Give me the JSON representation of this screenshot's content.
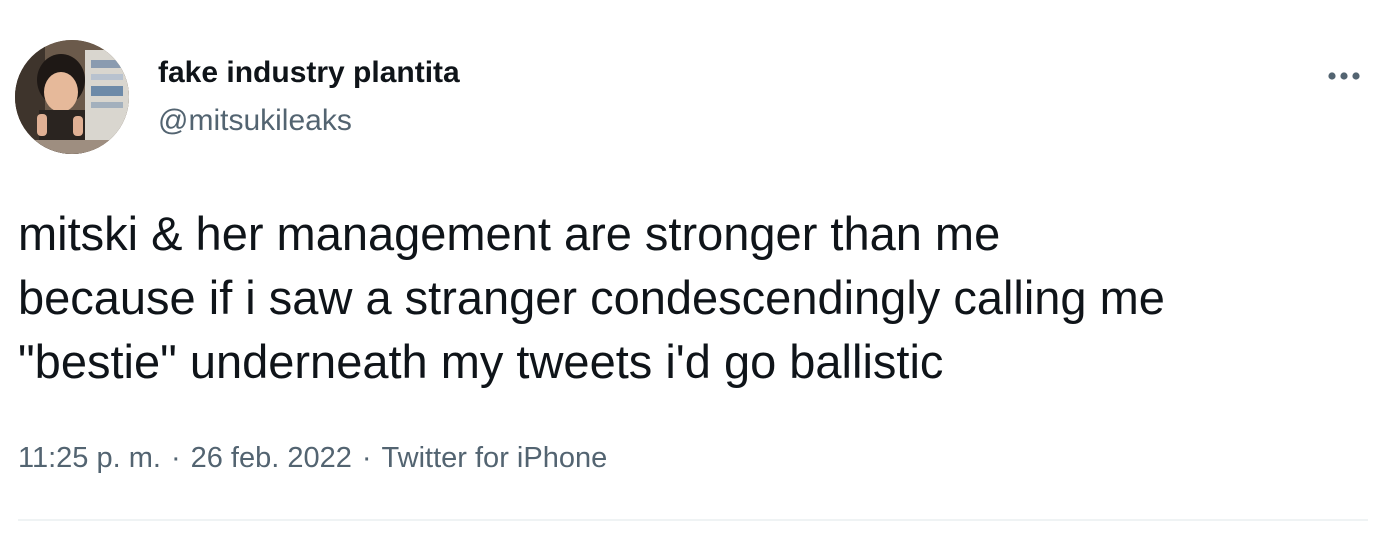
{
  "author": {
    "display_name": "fake industry plantita",
    "handle": "@mitsukileaks"
  },
  "tweet": {
    "lines": [
      "mitski & her management are stronger than me",
      "because if i saw a stranger condescendingly calling me",
      "\"bestie\" underneath my tweets i'd go ballistic"
    ]
  },
  "meta": {
    "time": "11:25 p. m.",
    "separator": "·",
    "date": "26 feb. 2022",
    "source": "Twitter for iPhone"
  },
  "icons": {
    "more": "more-horizontal-icon",
    "avatar": "profile-photo"
  },
  "colors": {
    "text": "#0f1419",
    "secondary": "#536471",
    "divider": "#eff3f4"
  }
}
